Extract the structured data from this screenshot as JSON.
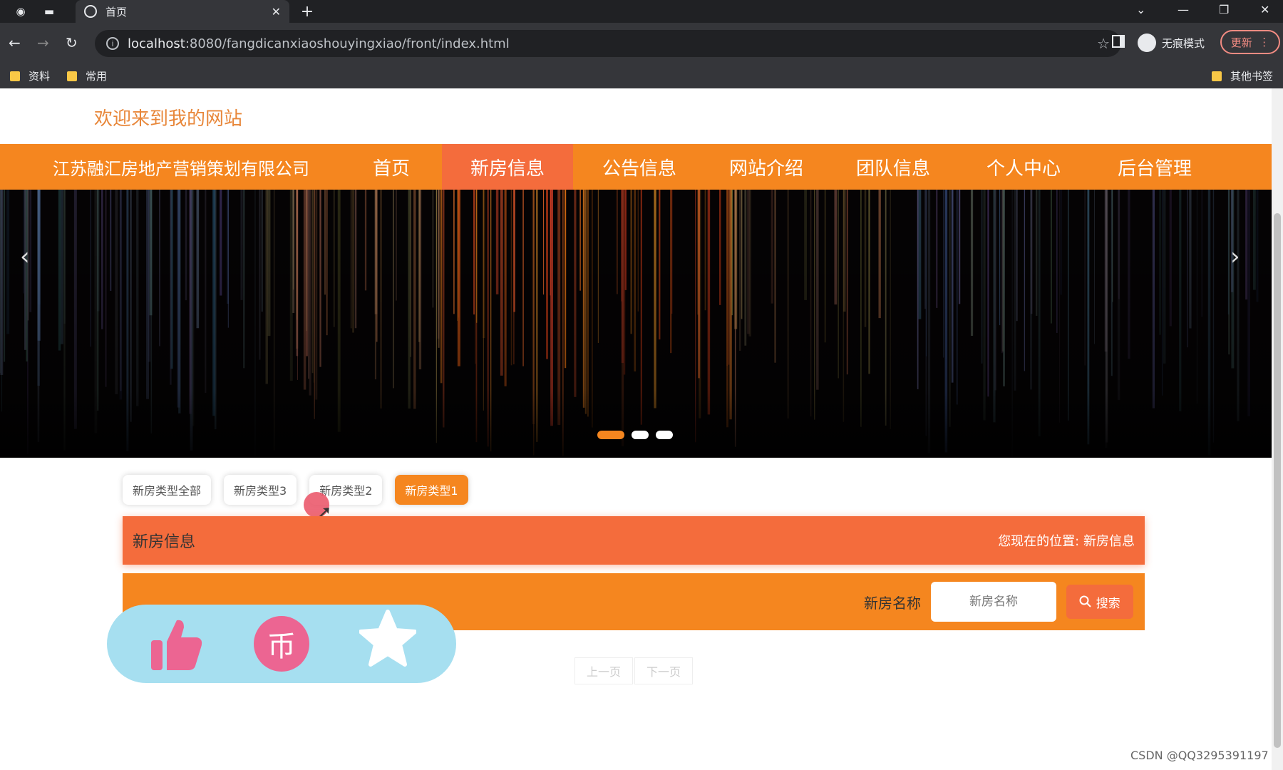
{
  "browser": {
    "tab_title": "首页",
    "url_host": "localhost",
    "url_rest": ":8080/fangdicanxiaoshouyingxiao/front/index.html",
    "incognito_label": "无痕模式",
    "update_label": "更新",
    "bookmarks": [
      "资料",
      "常用"
    ],
    "other_bookmarks": "其他书签"
  },
  "site": {
    "welcome": "欢迎来到我的网站",
    "brand": "江苏融汇房地产营销策划有限公司",
    "nav": [
      "首页",
      "新房信息",
      "公告信息",
      "网站介绍",
      "团队信息",
      "个人中心",
      "后台管理"
    ],
    "active_nav": "新房信息"
  },
  "filters": [
    "新房类型全部",
    "新房类型3",
    "新房类型2",
    "新房类型1"
  ],
  "active_filter": "新房类型1",
  "section": {
    "title": "新房信息",
    "location_label": "您现在的位置:",
    "location_value": "新房信息"
  },
  "search": {
    "label": "新房名称",
    "placeholder": "新房名称",
    "button": "搜索"
  },
  "pager": {
    "prev": "上一页",
    "next": "下一页"
  },
  "watermark": "CSDN @QQ3295391197",
  "colors": {
    "accent": "#f5861f",
    "accent_dark": "#f46c3c",
    "overlay": "#a6dff0",
    "coin": "#ec6592"
  }
}
